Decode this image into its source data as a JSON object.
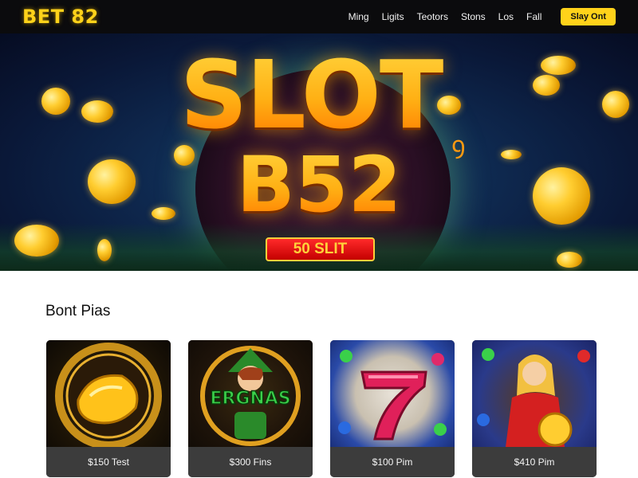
{
  "header": {
    "logo": "BET 82",
    "nav": [
      "Ming",
      "Ligits",
      "Teotors",
      "Stons",
      "Los",
      "Fall"
    ],
    "cta": "Slay Ont"
  },
  "hero": {
    "title": "SLOT",
    "subtitle": "B52",
    "badge": "50 SLIT"
  },
  "section": {
    "title": "Bont Pias"
  },
  "cards": [
    {
      "label": "$150 Test",
      "art": "golden-wheel"
    },
    {
      "label": "$300 Fins",
      "art": "ergnas-character"
    },
    {
      "label": "$100 Pim",
      "art": "lucky-seven"
    },
    {
      "label": "$410 Pim",
      "art": "coin-girl"
    }
  ],
  "colors": {
    "brand": "#ffd21a",
    "header_bg": "#0b0b0d",
    "badge_red": "#d40000",
    "card_label_bg": "#3c3c3c"
  }
}
